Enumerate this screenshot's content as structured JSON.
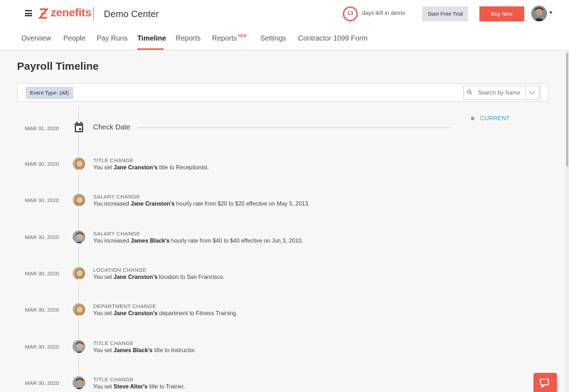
{
  "header": {
    "brand": "zenefits",
    "company": "Demo Center",
    "days_left": "13",
    "days_text": "days left in demo",
    "trial_label": "Start Free Trial",
    "buy_label": "Buy Now"
  },
  "nav": {
    "items": [
      "Overview",
      "People",
      "Pay Runs",
      "Timeline",
      "Reports",
      "Reports",
      "Settings",
      "Contractor 1099 Form"
    ],
    "active": "Timeline",
    "new_badge": "NEW"
  },
  "page": {
    "title": "Payroll Timeline",
    "filter_label": "Event Type: (All)",
    "search_placeholder": "Search by Name",
    "current_label": "CURRENT"
  },
  "check_date": {
    "date": "MAR 31, 2020",
    "label": "Check Date"
  },
  "events": [
    {
      "date": "MAR 30, 2020",
      "type": "TITLE CHANGE",
      "pre": "You set ",
      "name": "Jane Cranston's",
      "post": " title to Receptionist.",
      "person": "jane"
    },
    {
      "date": "MAR 30, 2020",
      "type": "SALARY CHANGE",
      "pre": "You increased ",
      "name": "Jane Cranston's",
      "post": " hourly rate from $20 to $20 effective on May 5, 2013.",
      "person": "jane"
    },
    {
      "date": "MAR 30, 2020",
      "type": "SALARY CHANGE",
      "pre": "You increased ",
      "name": "James Black's",
      "post": " hourly rate from $40 to $40 effective on Jun 3, 2010.",
      "person": "james"
    },
    {
      "date": "MAR 30, 2020",
      "type": "LOCATION CHANGE",
      "pre": "You set ",
      "name": "Jane Cranston's",
      "post": " location to San Francisco.",
      "person": "jane"
    },
    {
      "date": "MAR 30, 2020",
      "type": "DEPARTMENT CHANGE",
      "pre": "You set ",
      "name": "Jane Cranston's",
      "post": " department to Fitness Training.",
      "person": "jane"
    },
    {
      "date": "MAR 30, 2020",
      "type": "TITLE CHANGE",
      "pre": "You set ",
      "name": "James Black's",
      "post": " title to Instructor.",
      "person": "james"
    },
    {
      "date": "MAR 30, 2020",
      "type": "TITLE CHANGE",
      "pre": "You set ",
      "name": "Steve Alter's",
      "post": " title to Trainer.",
      "person": "steve"
    }
  ],
  "colors": {
    "brand": "#f05a4b",
    "current": "#3aa3b8",
    "chip": "#d3dde8"
  }
}
